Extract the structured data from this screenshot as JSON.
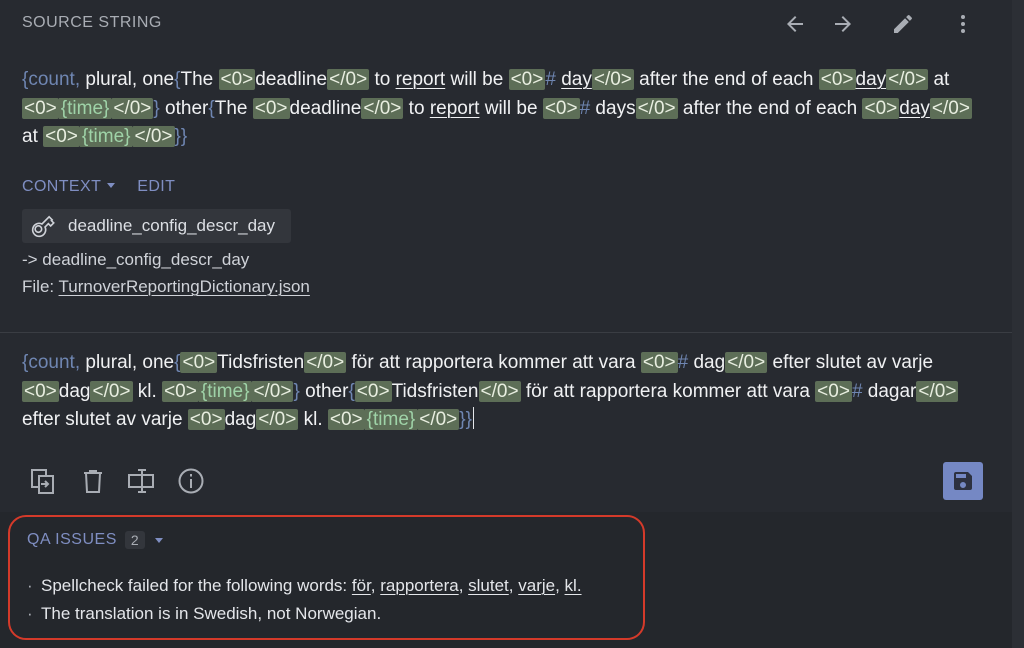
{
  "source_panel": {
    "title": "SOURCE STRING",
    "source_string": "{count, plural, one{The <0>deadline</0> to report will be <0># day</0> after the end of each <0>day</0> at <0>{time}</0>} other{The <0>deadline</0> to report will be <0># days</0> after the end of each <0>day</0> at <0>{time}</0>}}",
    "context_label": "CONTEXT",
    "edit_label": "EDIT",
    "key_name": "deadline_config_descr_day",
    "key_ref": "-> deadline_config_descr_day",
    "file_prefix": "File: ",
    "file_name": "TurnoverReportingDictionary.json"
  },
  "translation": {
    "text": "{count, plural, one{<0>Tidsfristen</0> för att rapportera kommer att vara <0># dag</0> efter slutet av varje <0>dag</0> kl. <0>{time}</0>} other{<0>Tidsfristen</0> för att rapportera kommer att vara <0># dagar</0> efter slutet av varje <0>dag</0> kl. <0>{time}</0>}}"
  },
  "qa": {
    "title": "QA ISSUES",
    "count": "2",
    "issue1_prefix": "Spellcheck failed for the following words: ",
    "issue1_words": [
      "för",
      "rapportera",
      "slutet",
      "varje",
      "kl."
    ],
    "issue2": "The translation is in Swedish, not Norwegian."
  },
  "icons": [
    "arrow-left-icon",
    "arrow-right-icon",
    "pencil-icon",
    "more-vert-icon",
    "key-icon",
    "copy-source-icon",
    "trash-icon",
    "text-cursor-icon",
    "info-icon",
    "save-icon",
    "chevron-down-icon"
  ],
  "colors": {
    "background": "#272a30",
    "accent": "#7588c4",
    "tag_bg": "#5d6e57",
    "qa_outline": "#d43a2a"
  }
}
